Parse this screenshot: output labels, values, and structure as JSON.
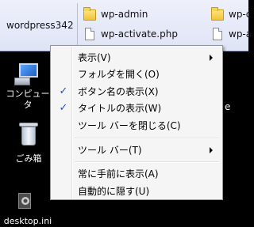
{
  "toolbar": {
    "label": "wordpress342",
    "items": [
      {
        "label": "wp-admin",
        "icon": "folder-icon"
      },
      {
        "label": "wp-c",
        "icon": "folder-icon"
      },
      {
        "label": "wp-activate.php",
        "icon": "file-icon"
      },
      {
        "label": "wp-a",
        "icon": "file-icon"
      }
    ]
  },
  "desktop": {
    "icons": [
      {
        "label_line1": "コンピュー",
        "label_line2": "タ",
        "icon": "computer-icon"
      },
      {
        "label_line1": "ごみ箱",
        "icon": "recycle-bin-icon"
      },
      {
        "label_line1": "desktop.ini",
        "icon": "settings-file-icon"
      }
    ],
    "partial_label": "e"
  },
  "menu": {
    "items": [
      {
        "label": "表示(V)",
        "checked": false,
        "submenu": true
      },
      {
        "label": "フォルダを開く(O)",
        "checked": false,
        "submenu": false
      },
      {
        "label": "ボタン名の表示(X)",
        "checked": true,
        "submenu": false
      },
      {
        "label": "タイトルの表示(W)",
        "checked": true,
        "submenu": false
      },
      {
        "label": "ツール バーを閉じる(C)",
        "checked": false,
        "submenu": false
      },
      {
        "label": "ツール バー(T)",
        "checked": false,
        "submenu": true
      },
      {
        "label": "常に手前に表示(A)",
        "checked": false,
        "submenu": false
      },
      {
        "label": "自動的に隠す(U)",
        "checked": false,
        "submenu": false
      }
    ],
    "check_glyph": "✓"
  }
}
